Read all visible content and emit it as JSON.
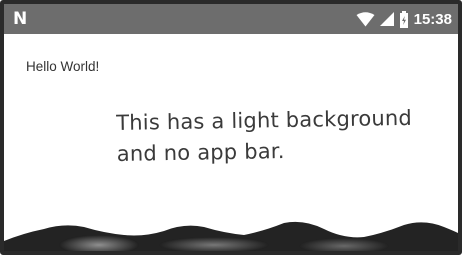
{
  "status_bar": {
    "logo_text": "N",
    "time": "15:38",
    "background_color": "#6d6d6d",
    "icons": [
      "wifi-icon",
      "signal-icon",
      "battery-icon"
    ]
  },
  "content": {
    "greeting": "Hello World!",
    "annotation": {
      "line1": "This has a light background",
      "line2": "and no app bar."
    }
  }
}
